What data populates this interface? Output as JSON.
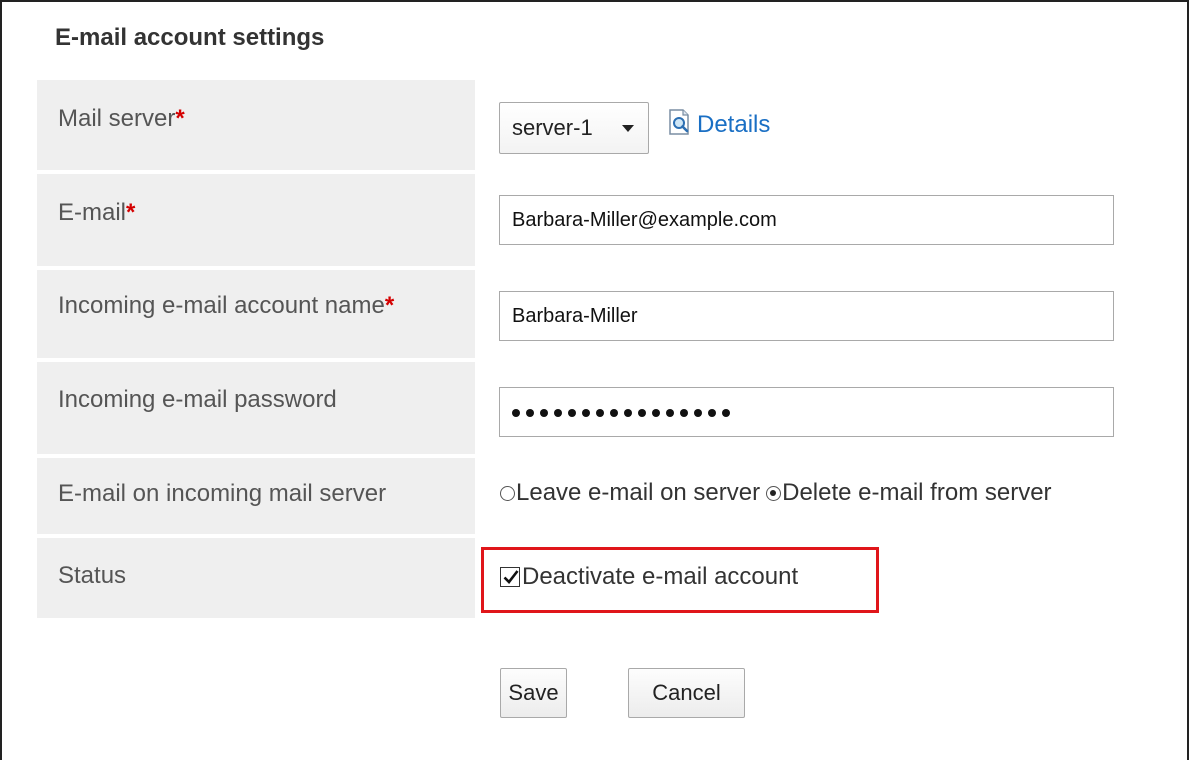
{
  "section": {
    "title": "E-mail account settings"
  },
  "fields": {
    "mail_server": {
      "label": "Mail server",
      "required_mark": "*",
      "value": "server-1",
      "details_link": "Details",
      "details_icon": "magnifier-document-icon"
    },
    "email": {
      "label": "E-mail",
      "required_mark": "*",
      "value": "Barbara-Miller@example.com"
    },
    "account_name": {
      "label": "Incoming e-mail account name",
      "required_mark": "*",
      "value": "Barbara-Miller"
    },
    "password": {
      "label": "Incoming e-mail password",
      "masked_length": 16
    },
    "incoming_server": {
      "label": "E-mail on incoming mail server",
      "options": [
        {
          "label": "Leave e-mail on server",
          "selected": false
        },
        {
          "label": "Delete e-mail from server",
          "selected": true
        }
      ]
    },
    "status": {
      "label": "Status",
      "checkbox_label": "Deactivate e-mail account",
      "checked": true
    }
  },
  "buttons": {
    "save": "Save",
    "cancel": "Cancel"
  },
  "colors": {
    "required": "#d40000",
    "link": "#1a6fc4",
    "highlight": "#e0161a",
    "label_bg": "#efefef"
  }
}
